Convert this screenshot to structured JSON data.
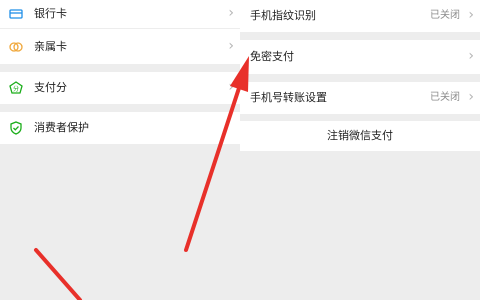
{
  "left": {
    "items": [
      {
        "label": "银行卡",
        "icon": "bank-card-icon"
      },
      {
        "label": "亲属卡",
        "icon": "family-card-icon"
      },
      {
        "label": "支付分",
        "icon": "payscore-icon"
      },
      {
        "label": "消费者保护",
        "icon": "consumer-protection-icon"
      }
    ]
  },
  "right": {
    "items": [
      {
        "label": "手机指纹识别",
        "value": "已关闭"
      },
      {
        "label": "免密支付",
        "value": ""
      },
      {
        "label": "手机号转账设置",
        "value": "已关闭"
      },
      {
        "label": "注销微信支付",
        "value": ""
      }
    ]
  },
  "colors": {
    "accent_green": "#1aad19",
    "arrow_red": "#e8302a",
    "page_bg": "#ededed"
  },
  "chevron": "›"
}
